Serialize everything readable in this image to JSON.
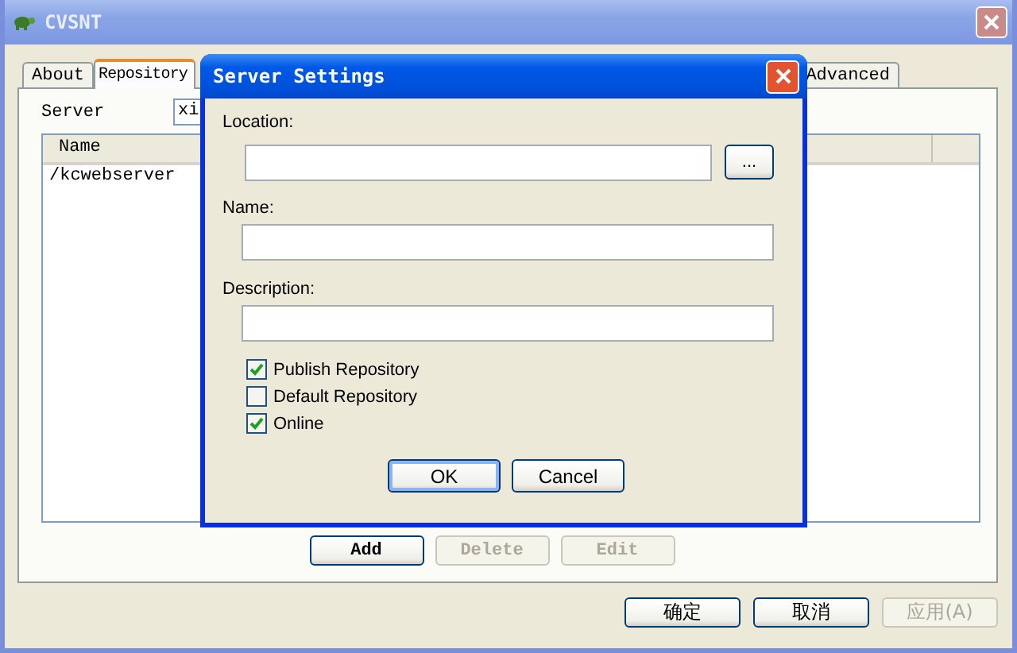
{
  "window": {
    "title": "CVSNT",
    "tabs": [
      {
        "label": "About",
        "selected": false
      },
      {
        "label": "Repository",
        "selected": true
      },
      {
        "label": "Advanced",
        "selected": false
      }
    ],
    "server": {
      "label": "Server",
      "value": "xi"
    },
    "list": {
      "columns": [
        "Name"
      ],
      "rows": [
        "/kcwebserver"
      ]
    },
    "list_buttons": [
      {
        "label": "Add",
        "disabled": false
      },
      {
        "label": "Delete",
        "disabled": true
      },
      {
        "label": "Edit",
        "disabled": true
      }
    ],
    "buttons": [
      {
        "label": "确定",
        "disabled": false
      },
      {
        "label": "取消",
        "disabled": false
      },
      {
        "label": "应用(A)",
        "disabled": true
      }
    ]
  },
  "dialog": {
    "title": "Server Settings",
    "fields": [
      {
        "label": "Location:",
        "browse": "..."
      },
      {
        "label": "Name:"
      },
      {
        "label": "Description:"
      }
    ],
    "checkboxes": [
      {
        "label": "Publish Repository",
        "checked": true
      },
      {
        "label": "Default Repository",
        "checked": false
      },
      {
        "label": "Online",
        "checked": true
      }
    ],
    "buttons": [
      {
        "label": "OK",
        "default": true
      },
      {
        "label": "Cancel",
        "default": false
      }
    ]
  }
}
